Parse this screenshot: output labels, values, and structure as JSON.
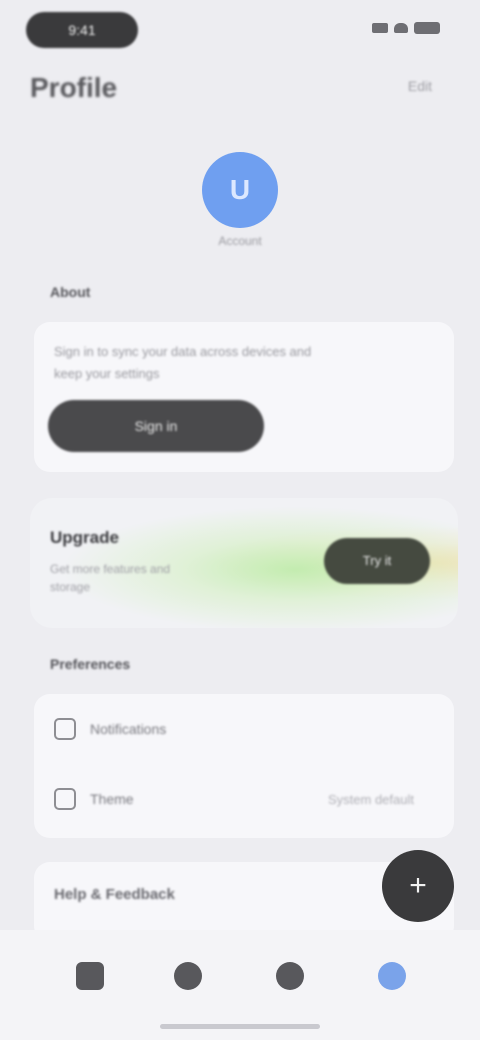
{
  "status_bar": {
    "time": "9:41",
    "icons": [
      "signal-icon",
      "wifi-icon",
      "battery-icon"
    ]
  },
  "header": {
    "title": "Profile",
    "action": "Edit"
  },
  "profile": {
    "avatar_letter": "U",
    "caption": "Account"
  },
  "account_section": {
    "label": "About",
    "description_line_1": "Sign in to sync your data across devices and",
    "description_line_2": "keep your settings",
    "button_label": "Sign in"
  },
  "promo": {
    "title": "Upgrade",
    "subtitle_line_1": "Get more features and",
    "subtitle_line_2": "storage",
    "button_label": "Try it"
  },
  "settings_section": {
    "label": "Preferences",
    "rows": [
      {
        "label": "Notifications",
        "value": ""
      },
      {
        "label": "Theme",
        "value": "System default"
      }
    ]
  },
  "footer_card": {
    "title": "Help & Feedback"
  },
  "fab": {
    "icon": "plus-icon",
    "glyph": "+"
  },
  "tabs": [
    {
      "name": "home",
      "icon": "home-icon",
      "active": false
    },
    {
      "name": "search",
      "icon": "search-icon",
      "active": false
    },
    {
      "name": "library",
      "icon": "library-icon",
      "active": false
    },
    {
      "name": "profile",
      "icon": "profile-icon",
      "active": true
    }
  ],
  "colors": {
    "background": "#ededf1",
    "accent": "#6f9ff0",
    "dark_button": "#4a4a4c"
  }
}
